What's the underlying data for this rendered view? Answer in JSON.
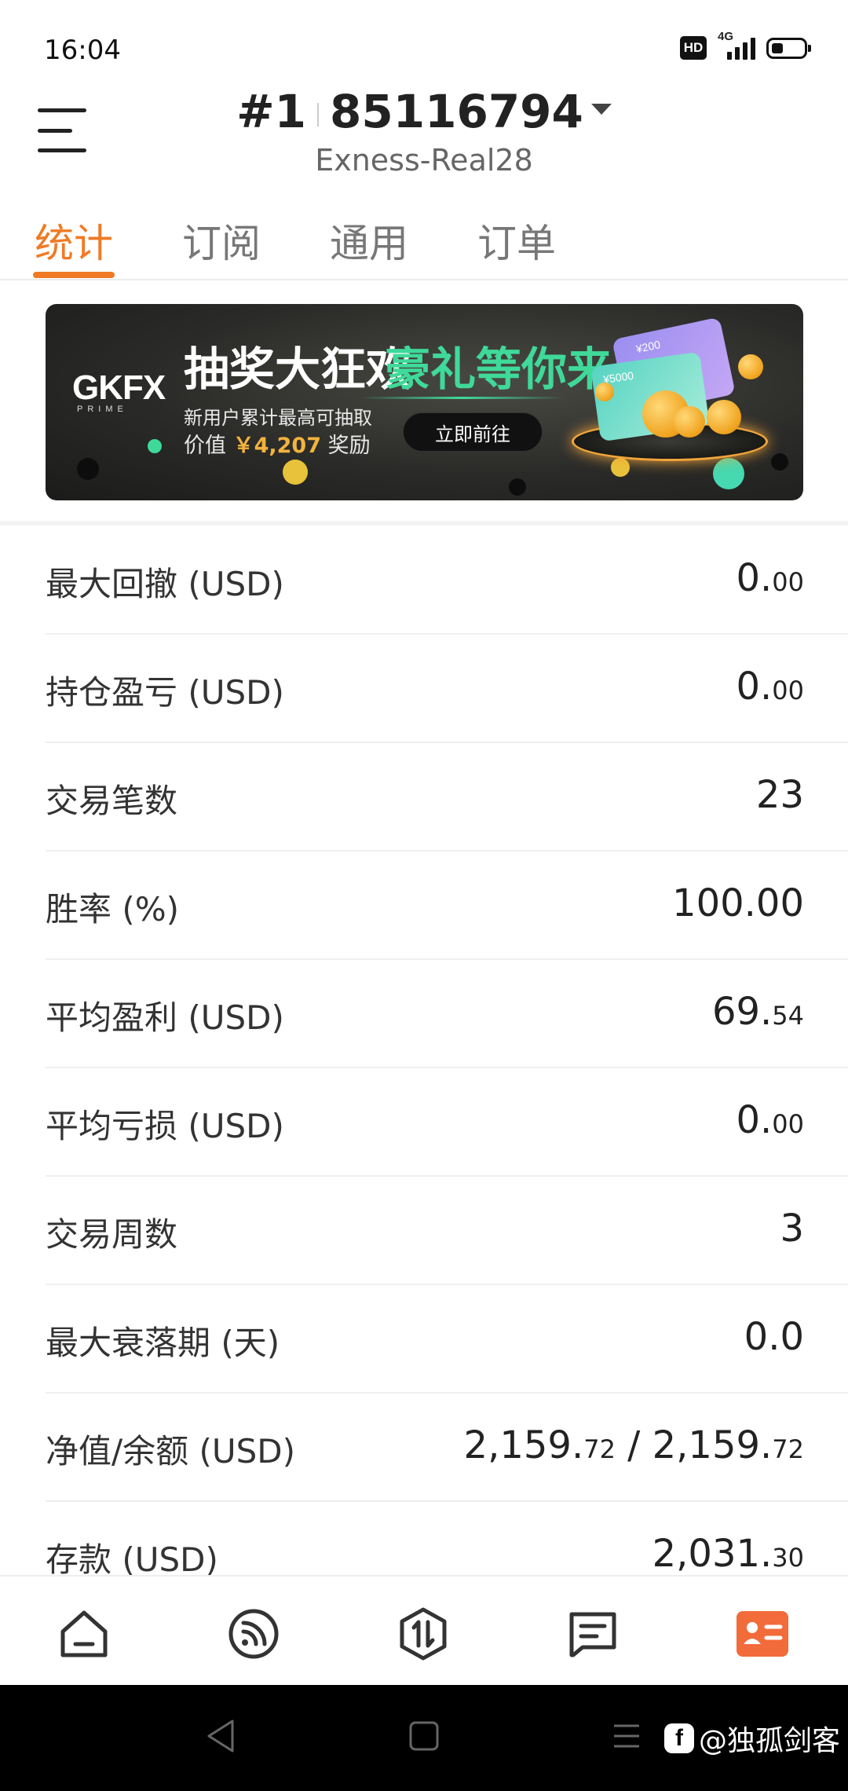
{
  "status_bar": {
    "time": "16:04",
    "hd": "HD",
    "network": "4G"
  },
  "header": {
    "account_prefix": "#1",
    "account_number": "85116794",
    "server": "Exness-Real28"
  },
  "tabs": [
    {
      "label": "统计",
      "active": true
    },
    {
      "label": "订阅",
      "active": false
    },
    {
      "label": "通用",
      "active": false
    },
    {
      "label": "订单",
      "active": false
    }
  ],
  "banner": {
    "logo": "GKFX",
    "logo_sub": "PRIME",
    "headline": "抽奖大狂欢",
    "headline_accent": "豪礼等你来",
    "line1": "新用户累计最高可抽取",
    "line2_prefix": "价值",
    "amount": "￥4,207",
    "line2_suffix": "奖励",
    "cta": "立即前往",
    "card_small": "¥200",
    "card_large": "¥5000"
  },
  "stats": [
    {
      "label": "最大回撤 (USD)",
      "int": "0.",
      "dec": "00"
    },
    {
      "label": "持仓盈亏 (USD)",
      "int": "0.",
      "dec": "00"
    },
    {
      "label": "交易笔数",
      "int": "23",
      "dec": ""
    },
    {
      "label": "胜率 (%)",
      "int": "100.00",
      "dec": ""
    },
    {
      "label": "平均盈利 (USD)",
      "int": "69.",
      "dec": "54"
    },
    {
      "label": "平均亏损 (USD)",
      "int": "0.",
      "dec": "00"
    },
    {
      "label": "交易周数",
      "int": "3",
      "dec": ""
    },
    {
      "label": "最大衰落期 (天)",
      "int": "0.0",
      "dec": ""
    },
    {
      "label": "净值/余额 (USD)",
      "int": "2,159.",
      "dec": "72",
      "int2": "2,159.",
      "dec2": "72"
    },
    {
      "label": "存款 (USD)",
      "int": "2,031.",
      "dec": "30"
    }
  ],
  "bottom_nav": [
    {
      "name": "home-icon",
      "active": false
    },
    {
      "name": "feed-icon",
      "active": false
    },
    {
      "name": "trade-icon",
      "active": false
    },
    {
      "name": "message-icon",
      "active": false
    },
    {
      "name": "profile-card-icon",
      "active": true
    }
  ],
  "colors": {
    "accent": "#f07a25",
    "banner_green": "#3fd99a",
    "banner_gold": "#f3b33d"
  },
  "watermark": "@独孤剑客"
}
